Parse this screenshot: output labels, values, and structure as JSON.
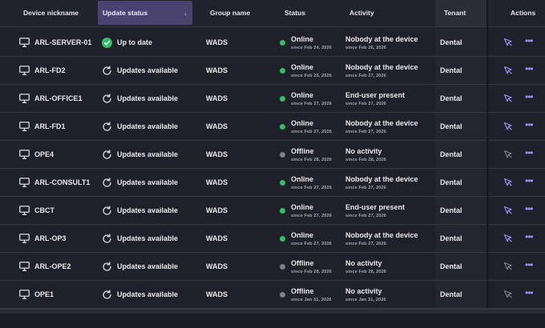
{
  "columns": {
    "device": "Device nickname",
    "update": "Update status",
    "update_sort_icon": "↓",
    "group": "Group name",
    "status": "Status",
    "activity": "Activity",
    "tenant": "Tenant",
    "actions": "Actions"
  },
  "colors": {
    "online": "#2fbf64",
    "offline": "#7b7f88",
    "accent": "#9a8ff0",
    "sorted_header": "#4a4370"
  },
  "rows": [
    {
      "device": "ARL-SERVER-01",
      "update": "Up to date",
      "update_icon": "check-circle-icon",
      "group": "WADS",
      "status": "Online",
      "status_since": "since Feb 24, 2026",
      "activity": "Nobody at the device",
      "activity_since": "since Feb 26, 2026",
      "tenant": "Dental",
      "cursor_active": true
    },
    {
      "device": "ARL-FD2",
      "update": "Updates available",
      "update_icon": "refresh-icon",
      "group": "WADS",
      "status": "Online",
      "status_since": "since Feb 25, 2026",
      "activity": "Nobody at the device",
      "activity_since": "since Feb 27, 2026",
      "tenant": "Dental",
      "cursor_active": true
    },
    {
      "device": "ARL-OFFICE1",
      "update": "Updates available",
      "update_icon": "refresh-icon",
      "group": "WADS",
      "status": "Online",
      "status_since": "since Feb 27, 2026",
      "activity": "End-user present",
      "activity_since": "since Feb 27, 2026",
      "tenant": "Dental",
      "cursor_active": true
    },
    {
      "device": "ARL-FD1",
      "update": "Updates available",
      "update_icon": "refresh-icon",
      "group": "WADS",
      "status": "Online",
      "status_since": "since Feb 27, 2026",
      "activity": "Nobody at the device",
      "activity_since": "since Feb 27, 2026",
      "tenant": "Dental",
      "cursor_active": true
    },
    {
      "device": "OPE4",
      "update": "Updates available",
      "update_icon": "refresh-icon",
      "group": "WADS",
      "status": "Offline",
      "status_since": "since Feb 28, 2026",
      "activity": "No activity",
      "activity_since": "since Feb 28, 2026",
      "tenant": "Dental",
      "cursor_active": false
    },
    {
      "device": "ARL-CONSULT1",
      "update": "Updates available",
      "update_icon": "refresh-icon",
      "group": "WADS",
      "status": "Online",
      "status_since": "since Feb 27, 2026",
      "activity": "Nobody at the device",
      "activity_since": "since Feb 27, 2026",
      "tenant": "Dental",
      "cursor_active": true
    },
    {
      "device": "CBCT",
      "update": "Updates available",
      "update_icon": "refresh-icon",
      "group": "WADS",
      "status": "Online",
      "status_since": "since Feb 27, 2026",
      "activity": "End-user present",
      "activity_since": "since Feb 27, 2026",
      "tenant": "Dental",
      "cursor_active": true
    },
    {
      "device": "ARL-OP3",
      "update": "Updates available",
      "update_icon": "refresh-icon",
      "group": "WADS",
      "status": "Online",
      "status_since": "since Feb 27, 2026",
      "activity": "Nobody at the device",
      "activity_since": "since Feb 27, 2026",
      "tenant": "Dental",
      "cursor_active": true
    },
    {
      "device": "ARL-OPE2",
      "update": "Updates available",
      "update_icon": "refresh-icon",
      "group": "WADS",
      "status": "Offline",
      "status_since": "since Feb 28, 2026",
      "activity": "No activity",
      "activity_since": "since Feb 28, 2026",
      "tenant": "Dental",
      "cursor_active": false
    },
    {
      "device": "OPE1",
      "update": "Updates available",
      "update_icon": "refresh-icon",
      "group": "WADS",
      "status": "Offline",
      "status_since": "since Jan 31, 2026",
      "activity": "No activity",
      "activity_since": "since Jan 31, 2026",
      "tenant": "Dental",
      "cursor_active": false
    }
  ]
}
